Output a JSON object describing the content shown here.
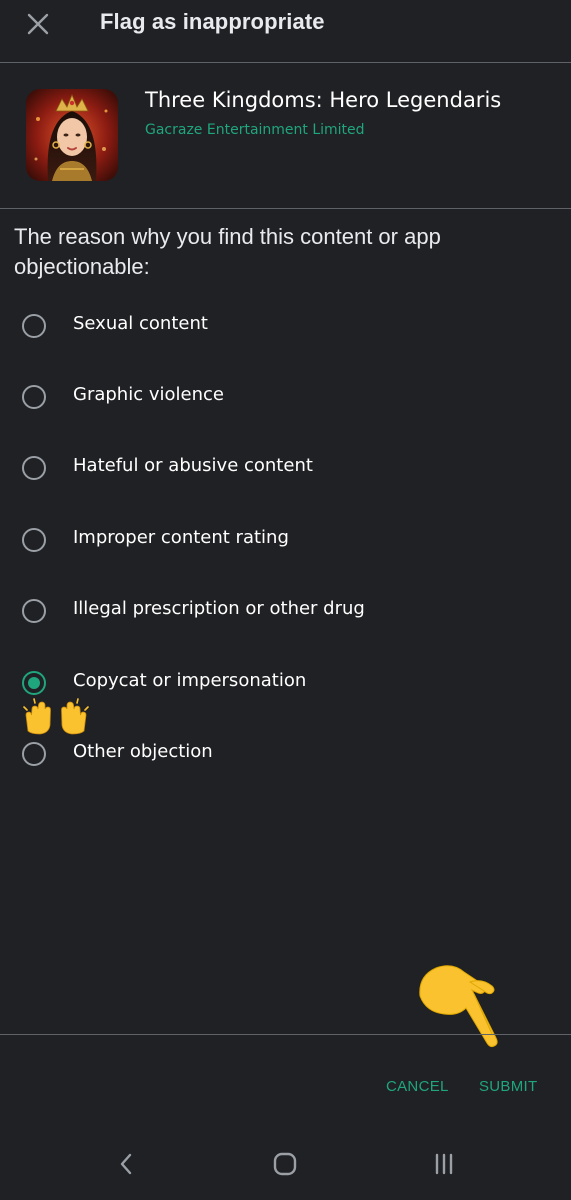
{
  "header": {
    "title": "Flag as inappropriate",
    "close_icon": "close-icon"
  },
  "app": {
    "name": "Three Kingdoms: Hero Legendaris",
    "developer": "Gacraze Entertainment Limited"
  },
  "form": {
    "prompt": "The reason why you find this content or app objectionable:",
    "selected_index": 5,
    "options": [
      {
        "label": "Sexual content",
        "checked": false
      },
      {
        "label": "Graphic violence",
        "checked": false
      },
      {
        "label": "Hateful or abusive content",
        "checked": false
      },
      {
        "label": "Improper content rating",
        "checked": false
      },
      {
        "label": "Illegal prescription or other drug",
        "checked": false
      },
      {
        "label": "Copycat or impersonation",
        "checked": true
      },
      {
        "label": "Other objection",
        "checked": false
      }
    ]
  },
  "actions": {
    "cancel_label": "CANCEL",
    "submit_label": "SUBMIT"
  },
  "annotations": {
    "hands_emoji": "raising-hands-emoji",
    "pointing_hand": "pointing-hand-icon"
  },
  "nav": {
    "back_icon": "back-icon",
    "home_icon": "home-icon",
    "recents_icon": "recents-icon"
  },
  "colors": {
    "background": "#202124",
    "accent": "#1fa67c",
    "divider": "#5f6368",
    "text": "#e8eaed"
  }
}
